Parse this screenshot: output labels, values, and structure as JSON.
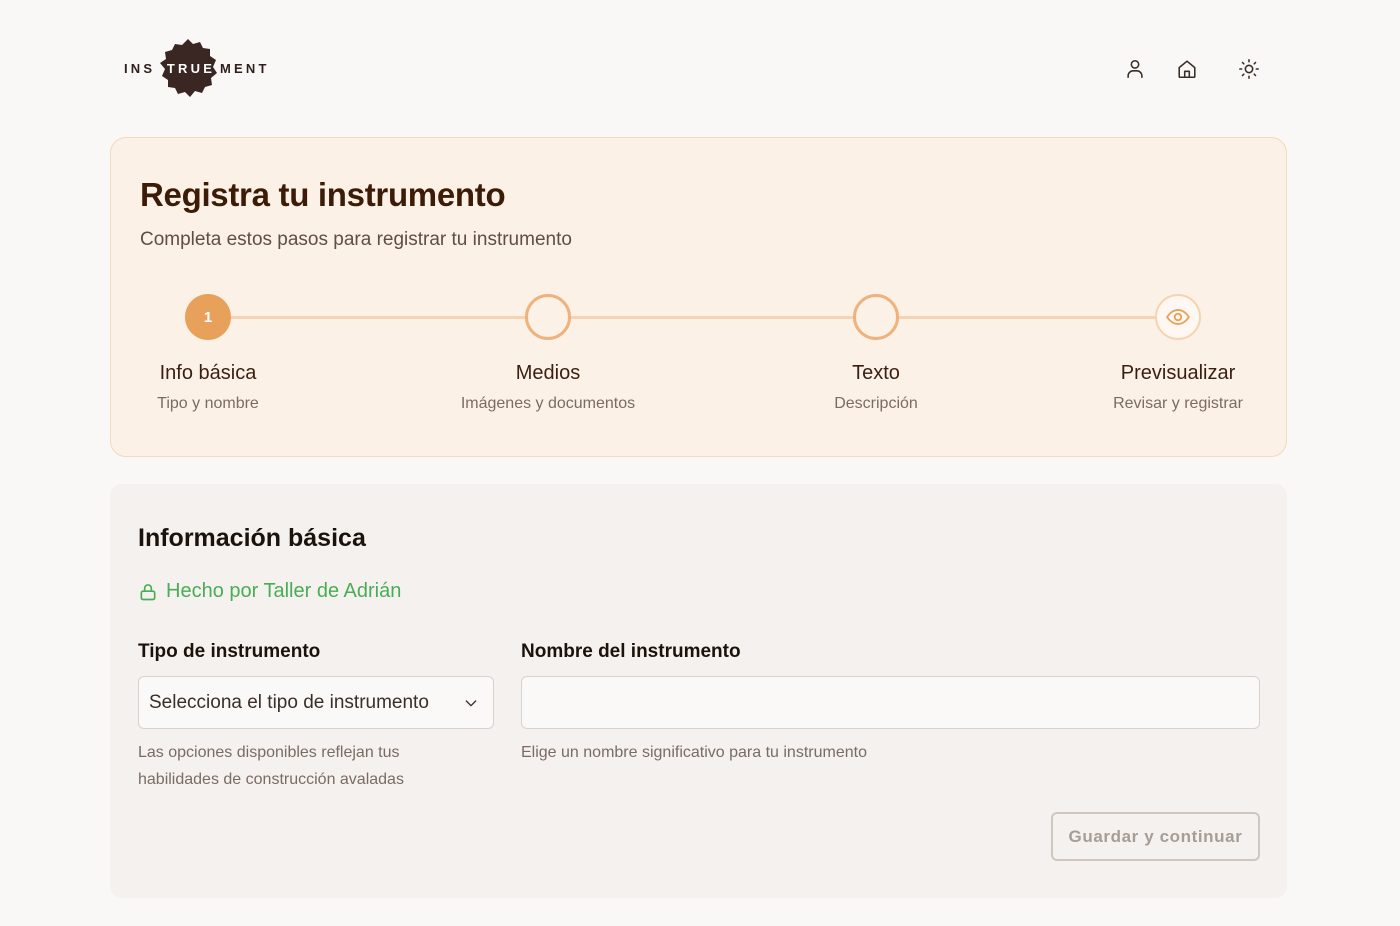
{
  "header": {
    "logo": {
      "left": "INS",
      "middle": "TRUE",
      "right": "MENT"
    },
    "icons": [
      "user-icon",
      "home-icon",
      "sun-icon"
    ]
  },
  "wizard": {
    "title": "Registra tu instrumento",
    "subtitle": "Completa estos pasos para registrar tu instrumento",
    "steps": [
      {
        "number": "1",
        "label": "Info básica",
        "description": "Tipo y nombre",
        "state": "active"
      },
      {
        "label": "Medios",
        "description": "Imágenes y documentos",
        "state": "pending"
      },
      {
        "label": "Texto",
        "description": "Descripción",
        "state": "pending"
      },
      {
        "label": "Previsualizar",
        "description": "Revisar y registrar",
        "state": "pending",
        "icon": "eye-icon"
      }
    ]
  },
  "form": {
    "title": "Información básica",
    "maker": "Hecho por Taller de Adrián",
    "type_field": {
      "label": "Tipo de instrumento",
      "placeholder": "Selecciona el tipo de instrumento",
      "hint_line1": "Las opciones disponibles reflejan tus",
      "hint_line2": "habilidades de construcción avaladas"
    },
    "name_field": {
      "label": "Nombre del instrumento",
      "value": "",
      "hint": "Elige un nombre significativo para tu instrumento"
    },
    "submit_label": "Guardar y continuar"
  },
  "colors": {
    "accent": "#e8a15a",
    "success": "#4aad55",
    "card_bg": "#fcf1e7",
    "title": "#3d1c07"
  }
}
